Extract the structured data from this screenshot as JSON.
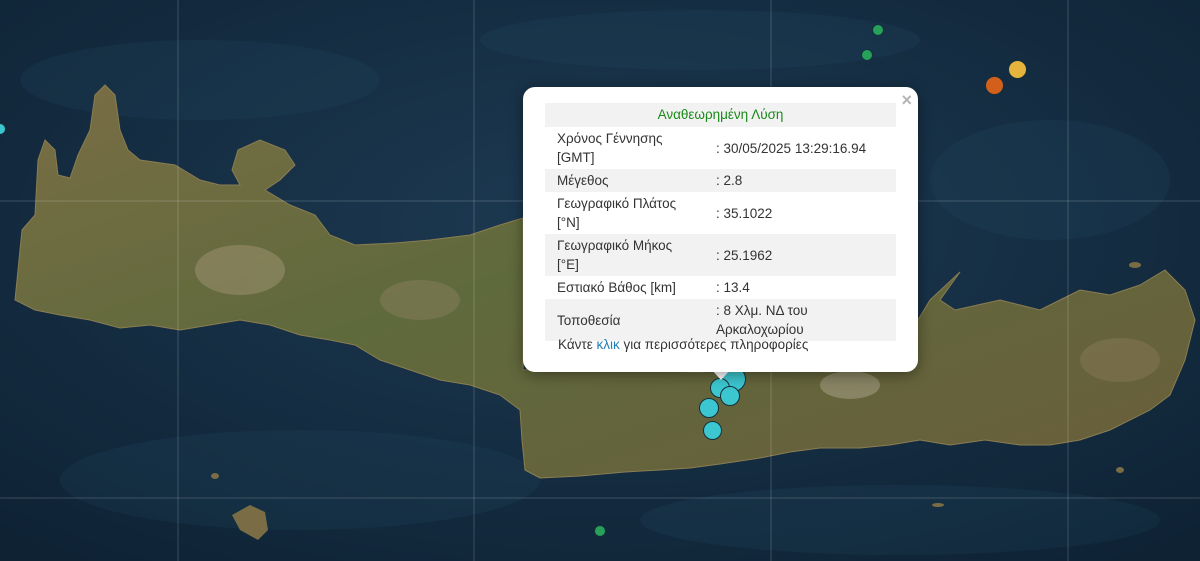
{
  "popup": {
    "title": "Αναθεωρημένη Λύση",
    "close_symbol": "×",
    "rows": [
      {
        "label": "Χρόνος Γέννησης [GMT]",
        "value": ": 30/05/2025 13:29:16.94"
      },
      {
        "label": "Μέγεθος",
        "value": ": 2.8"
      },
      {
        "label": "Γεωγραφικό Πλάτος [°N]",
        "value": ": 35.1022"
      },
      {
        "label": "Γεωγραφικό Μήκος [°E]",
        "value": ": 25.1962"
      },
      {
        "label": "Εστιακό Βάθος [km]",
        "value": ": 13.4"
      },
      {
        "label": "Τοποθεσία",
        "value": ": 8 Χλμ. ΝΔ του Αρκαλοχωρίου"
      }
    ],
    "footer_prefix": "Κάντε ",
    "footer_link": "κλικ",
    "footer_suffix": " για περισσότερες πληροφορίες"
  },
  "colors": {
    "sea": "#163046",
    "land": "#6e6540",
    "marker_recent": "#3cc6d0",
    "marker_green": "#27a05a",
    "marker_orange": "#d2601a",
    "marker_yellow": "#e6b43c",
    "accent_title": "#1a8a1a",
    "link": "#1f7fb8"
  }
}
